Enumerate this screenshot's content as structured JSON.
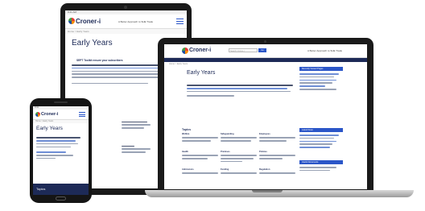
{
  "brand": {
    "logo_text": "Croner-i"
  },
  "page": {
    "title": "Early Years"
  },
  "tablet": {
    "status_time": "9:41 AM",
    "header_right_text": "A Better Approach to SHE Trade",
    "breadcrumb": "Home > Early Years",
    "intro_heading": "SEPT Toolkit ensure your subscribers"
  },
  "laptop": {
    "search_placeholder": "Search Croner-i",
    "search_button": "Go",
    "header_right_text": "A Better Approach to SHE Trade",
    "breadcrumb": "Home > Early Years",
    "topics_label": "Topics",
    "sidebar_heading": "Recently Viewed Pages",
    "sidebar_heading_2": "Latest News",
    "sidebar_heading_3": "Useful Documents",
    "topic_cells": [
      "Welfare",
      "Safeguarding",
      "Employees",
      "Health",
      "Premises",
      "Policies",
      "Admissions",
      "Funding",
      "Regulation"
    ]
  },
  "phone": {
    "status_time": "9:41",
    "breadcrumb": "Home > Early Years",
    "topics_label": "Topics"
  }
}
